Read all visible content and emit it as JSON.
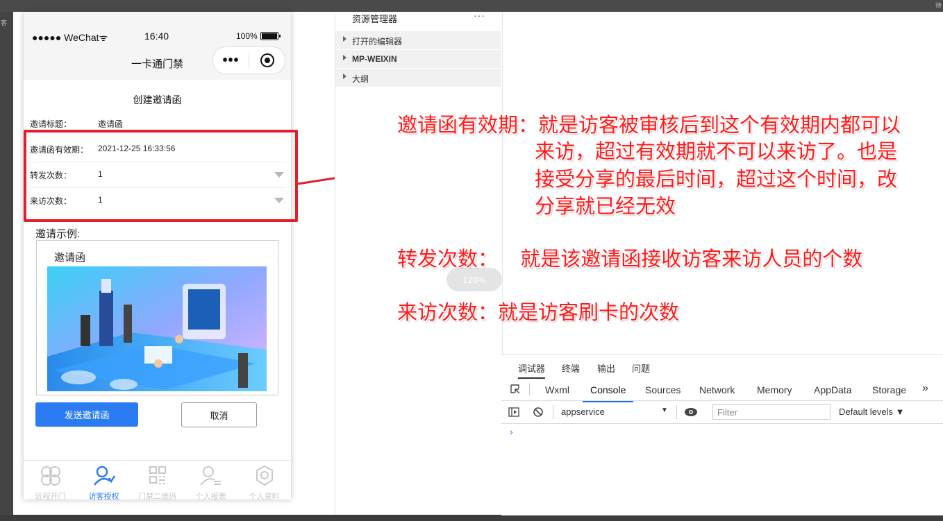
{
  "window": {
    "side_label": "客",
    "right_label": "待"
  },
  "phone": {
    "status": {
      "carrier": "●●●●● WeChat",
      "wifi_glyph": "ᯤ",
      "time": "16:40",
      "battery": "100%"
    },
    "nav_title": "一卡通门禁",
    "capsule": {
      "more": "•••"
    },
    "form": {
      "title": "创建邀请函",
      "rows": [
        {
          "label": "邀请标题：",
          "value": "邀请函"
        },
        {
          "label": "邀请函有效期：",
          "value": "2021-12-25 16:33:56"
        },
        {
          "label": "转发次数：",
          "value": "1"
        },
        {
          "label": "来访次数：",
          "value": "1"
        }
      ]
    },
    "example": {
      "label": "邀请示例:",
      "card_title": "邀请函"
    },
    "buttons": {
      "send": "发送邀请函",
      "cancel": "取消"
    },
    "tabbar": [
      {
        "label": "远程开门",
        "icon": "clover-icon",
        "active": false
      },
      {
        "label": "访客授权",
        "icon": "visitor-check-icon",
        "active": true
      },
      {
        "label": "门禁二维码",
        "icon": "qrcode-icon",
        "active": false
      },
      {
        "label": "个人报表",
        "icon": "person-report-icon",
        "active": false
      },
      {
        "label": "个人资料",
        "icon": "gear-icon",
        "active": false
      }
    ]
  },
  "explorer": {
    "title": "资源管理器",
    "more": "···",
    "sections": [
      "打开的编辑器",
      "MP-WEIXIN",
      "大纲"
    ]
  },
  "zoom": "120%",
  "annotations": {
    "validity": [
      "邀请函有效期：就是访客被审核后到这个有效期内都可以",
      "来访，超过有效期就不可以来访了。也是",
      "接受分享的最后时间，超过这个时间，改",
      "分享就已经无效"
    ],
    "forward": "转发次数：    就是该邀请函接收访客来访人员的个数",
    "visits": "来访次数：就是访客刷卡的次数"
  },
  "devtools": {
    "top_tabs": [
      "调试器",
      "终端",
      "输出",
      "问题"
    ],
    "tabs": [
      "Wxml",
      "Console",
      "Sources",
      "Network",
      "Memory",
      "AppData",
      "Storage"
    ],
    "more": "»",
    "context": "appservice",
    "filter_placeholder": "Filter",
    "levels": "Default levels ▼",
    "prompt": "›"
  },
  "colors": {
    "accent": "#2b7cf3",
    "annotation": "#ff1a1a",
    "highlight_box": "#e0202a"
  }
}
